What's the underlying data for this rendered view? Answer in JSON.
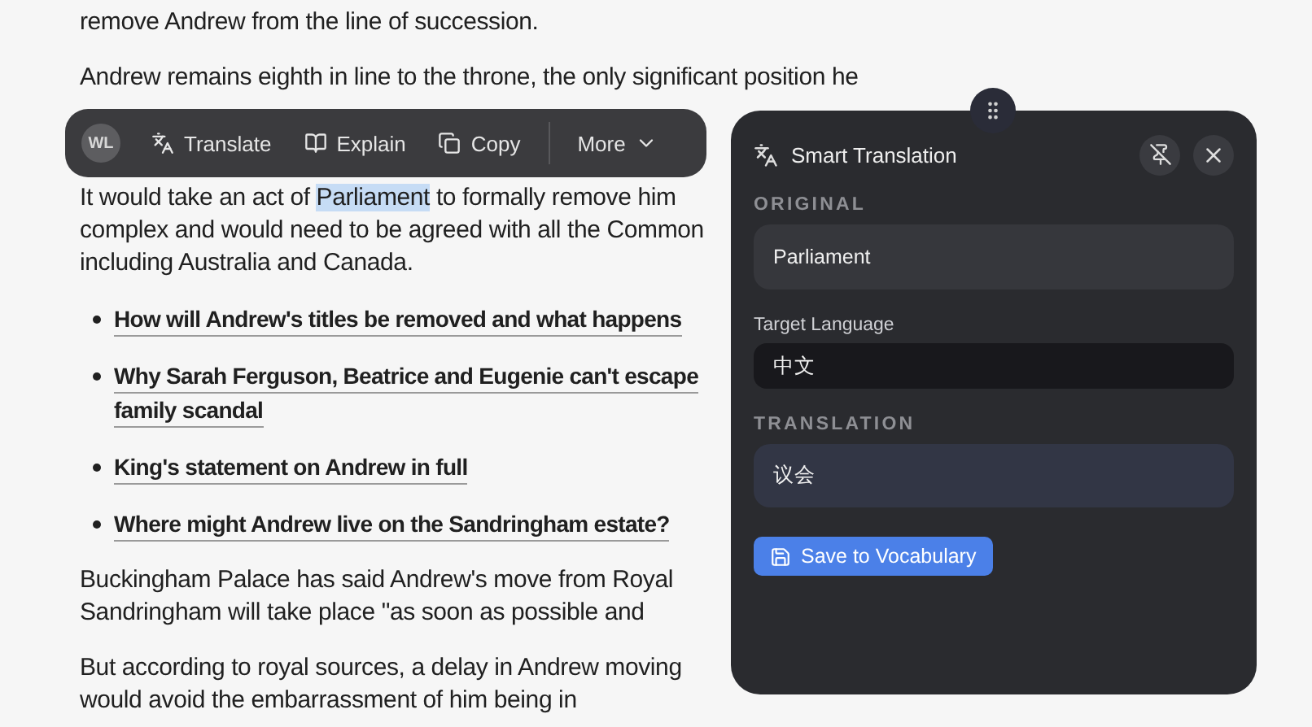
{
  "article": {
    "paragraphs": [
      {
        "kind": "text",
        "lines": [
          [
            {
              "text": "remove Andrew from the line of succession.",
              "highlighted": false
            }
          ]
        ]
      },
      {
        "kind": "text",
        "lines": [
          [
            {
              "text": "Andrew remains eighth in line to the throne, the only significant position he",
              "highlighted": false
            }
          ]
        ]
      },
      {
        "kind": "text",
        "lines": [
          [
            {
              "text": "It would take an act of ",
              "highlighted": false
            },
            {
              "text": "Parliament",
              "highlighted": true
            },
            {
              "text": " to formally remove him",
              "highlighted": false
            }
          ],
          [
            {
              "text": "complex and would need to be agreed with all the Common",
              "highlighted": false
            }
          ],
          [
            {
              "text": "including Australia and Canada.",
              "highlighted": false
            }
          ]
        ]
      },
      {
        "kind": "links",
        "items": [
          {
            "lines": [
              "How will Andrew's titles be removed and what happens"
            ]
          },
          {
            "lines": [
              "Why Sarah Ferguson, Beatrice and Eugenie can't escape",
              "family scandal"
            ]
          },
          {
            "lines": [
              "King's statement on Andrew in full"
            ]
          },
          {
            "lines": [
              "Where might Andrew live on the Sandringham estate?"
            ]
          }
        ]
      },
      {
        "kind": "text",
        "lines": [
          [
            {
              "text": "Buckingham Palace has said Andrew's move from Royal",
              "highlighted": false
            }
          ],
          [
            {
              "text": "Sandringham will take place \"as soon as possible and",
              "highlighted": false
            }
          ]
        ]
      },
      {
        "kind": "text",
        "lines": [
          [
            {
              "text": "But according to royal sources, a delay in Andrew moving",
              "highlighted": false
            }
          ],
          [
            {
              "text": "would avoid the embarrassment of him being in",
              "highlighted": false
            }
          ]
        ]
      }
    ]
  },
  "toolbar": {
    "avatar": "WL",
    "buttons": [
      {
        "kind": "translate",
        "label": "Translate"
      },
      {
        "kind": "explain",
        "label": "Explain"
      },
      {
        "kind": "copy",
        "label": "Copy"
      },
      {
        "kind": "more",
        "label": "More"
      }
    ]
  },
  "panel": {
    "title": "Smart Translation",
    "original": {
      "label": "ORIGINAL",
      "value": "Parliament"
    },
    "target_language": {
      "label": "Target Language",
      "value": "中文"
    },
    "translation": {
      "label": "TRANSLATION",
      "value": "议会"
    },
    "save_button": "Save to Vocabulary"
  }
}
